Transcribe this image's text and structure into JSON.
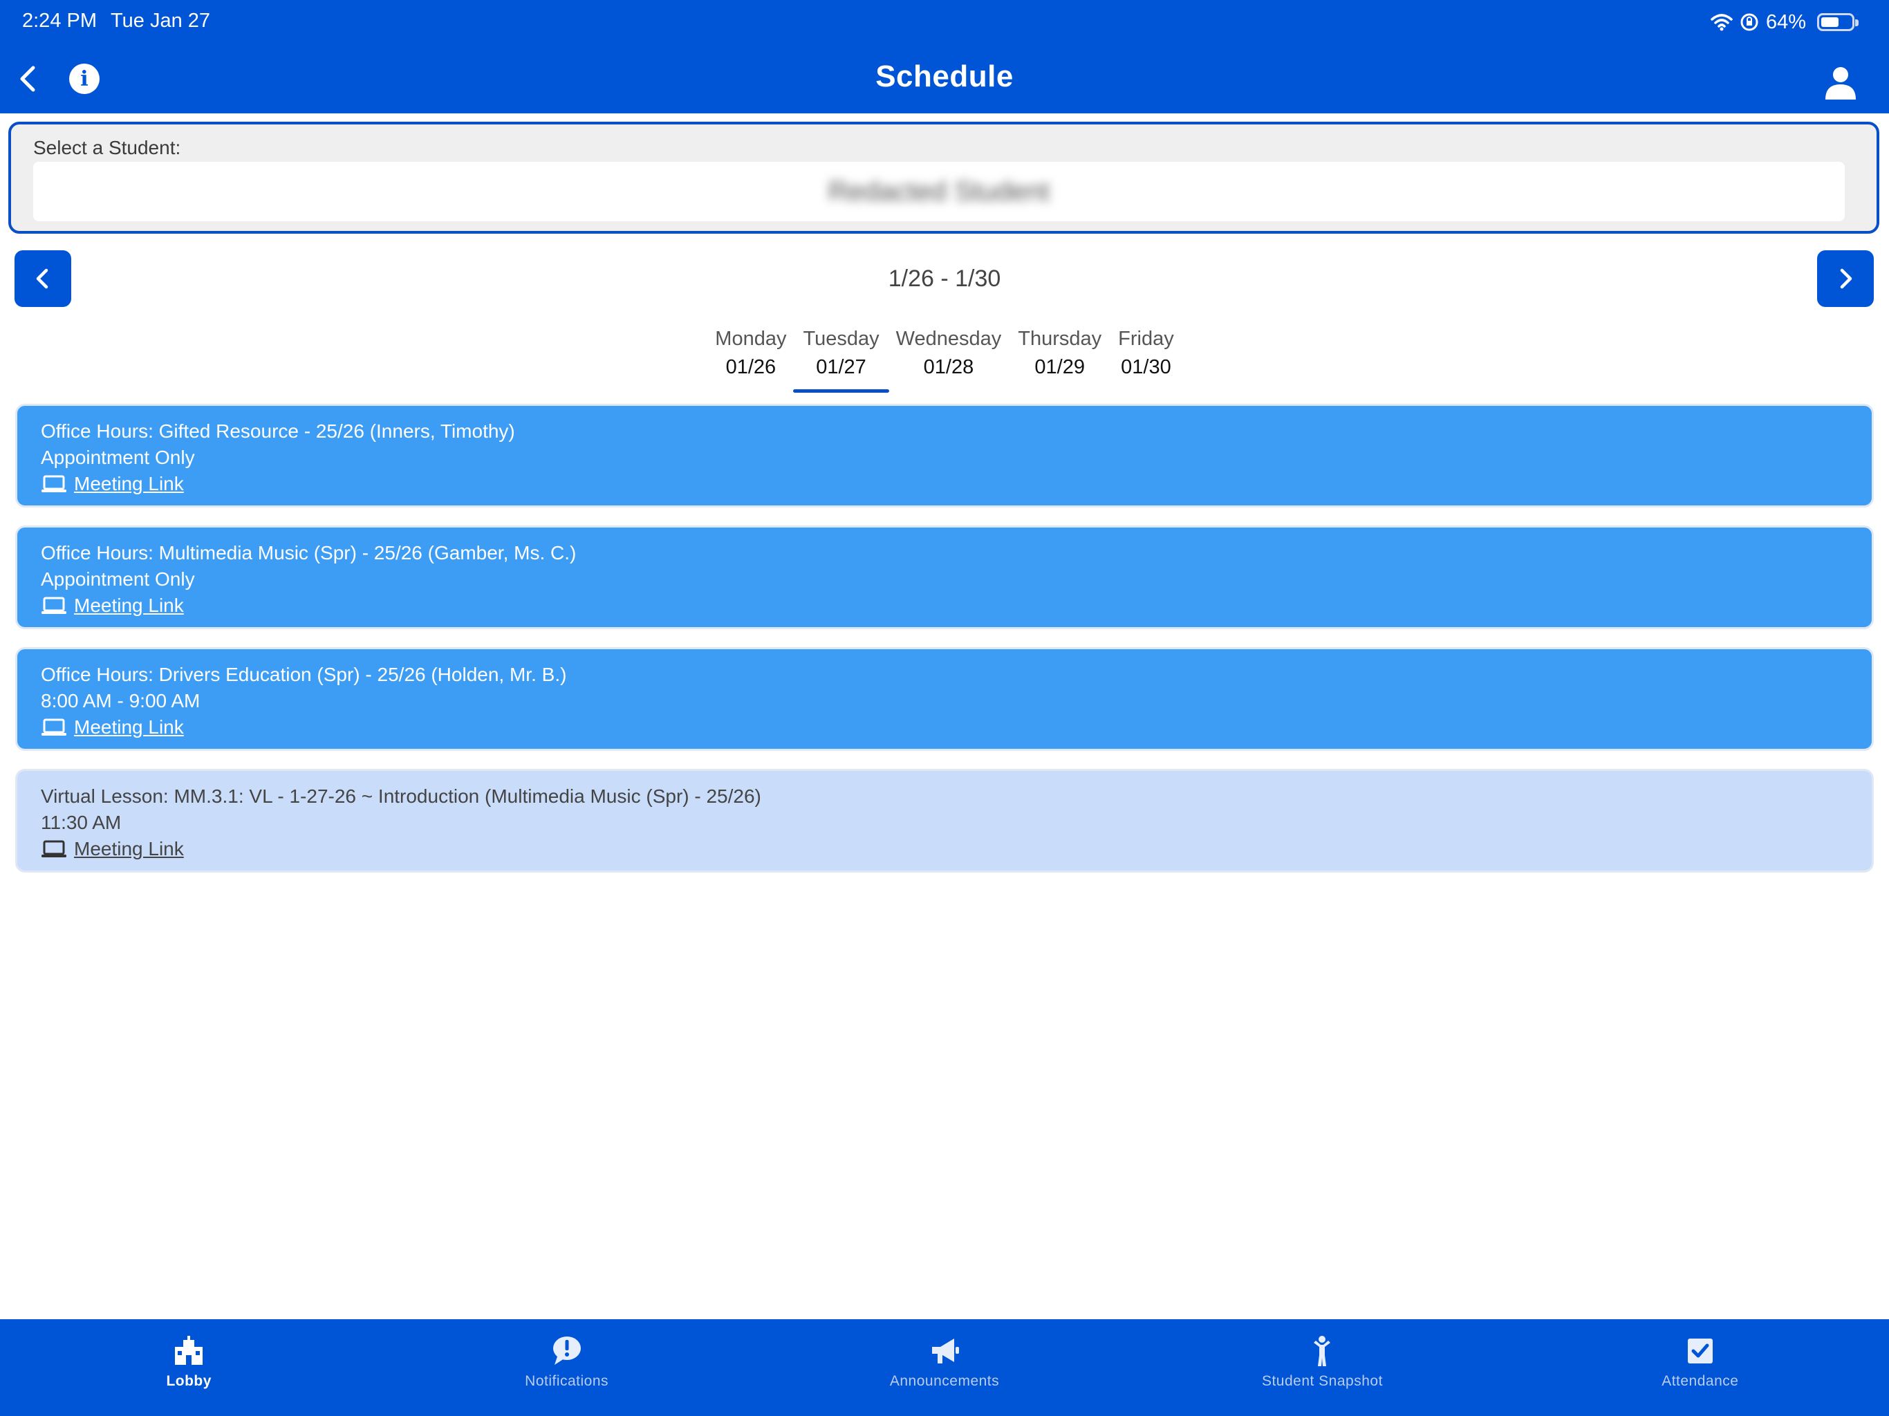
{
  "status_bar": {
    "time": "2:24 PM",
    "date": "Tue Jan 27",
    "battery": "64%",
    "battery_level": 0.64
  },
  "header": {
    "title": "Schedule",
    "back_icon": "chevron-left-icon",
    "info_icon": "info-icon",
    "profile_icon": "person-icon"
  },
  "student_selector": {
    "label": "Select a Student:",
    "value": "Redacted Student"
  },
  "week": {
    "range": "1/26 - 1/30"
  },
  "days": [
    {
      "name": "Monday",
      "date": "01/26"
    },
    {
      "name": "Tuesday",
      "date": "01/27"
    },
    {
      "name": "Wednesday",
      "date": "01/28"
    },
    {
      "name": "Thursday",
      "date": "01/29"
    },
    {
      "name": "Friday",
      "date": "01/30"
    }
  ],
  "active_day": "Tuesday",
  "events": [
    {
      "title": "Office Hours: Gifted Resource - 25/26 (Inners, Timothy)",
      "detail": "Appointment Only",
      "link": "Meeting Link"
    },
    {
      "title": "Office Hours: Multimedia Music (Spr) - 25/26 (Gamber, Ms. C.)",
      "detail": "Appointment Only",
      "link": "Meeting Link"
    },
    {
      "title": "Office Hours: Drivers Education (Spr) - 25/26 (Holden, Mr. B.)",
      "detail": "8:00 AM - 9:00 AM",
      "link": "Meeting Link"
    },
    {
      "title": "Virtual Lesson: MM.3.1:  VL - 1-27-26 ~ Introduction (Multimedia Music (Spr) - 25/26)",
      "detail": "11:30 AM",
      "link": "Meeting Link"
    }
  ],
  "tabbar": [
    {
      "label": "Lobby",
      "icon": "school-building-icon"
    },
    {
      "label": "Notifications",
      "icon": "alert-bubble-icon"
    },
    {
      "label": "Announcements",
      "icon": "megaphone-icon"
    },
    {
      "label": "Student Snapshot",
      "icon": "student-figure-icon"
    },
    {
      "label": "Attendance",
      "icon": "checkbox-icon"
    }
  ],
  "colors": {
    "primary": "#0054d6",
    "office_card": "#3d9df5",
    "virtual_card": "#c9ddfb"
  }
}
